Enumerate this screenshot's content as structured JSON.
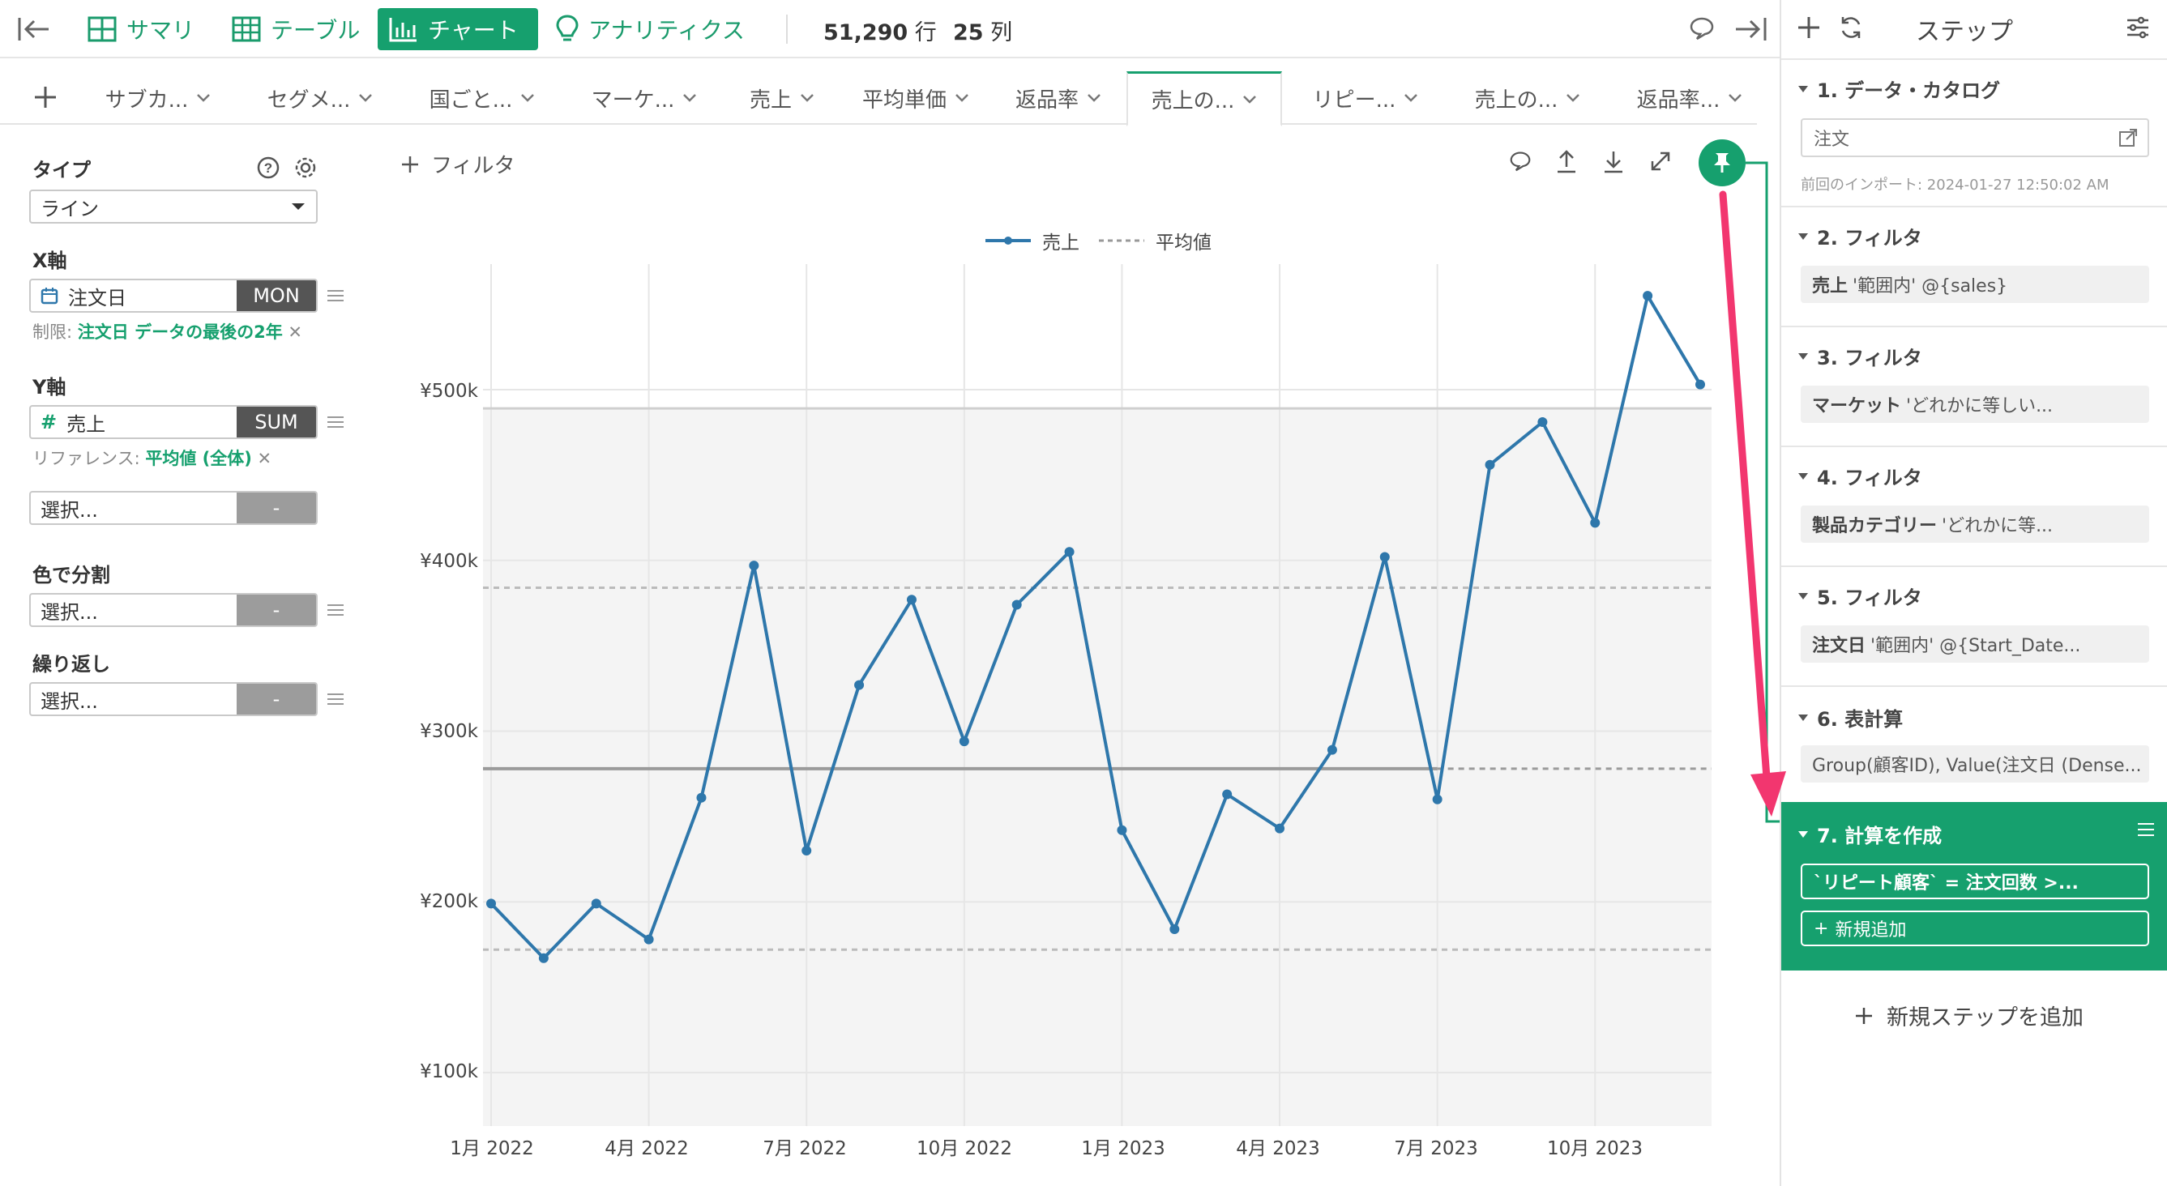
{
  "toolbar": {
    "summary": "サマリ",
    "table": "テーブル",
    "chart": "チャート",
    "analytics": "アナリティクス",
    "rows_value": "51,290",
    "rows_unit": "行",
    "cols_value": "25",
    "cols_unit": "列"
  },
  "tabs": [
    {
      "label": "サブカ..."
    },
    {
      "label": "セグメ..."
    },
    {
      "label": "国ごと..."
    },
    {
      "label": "マーケ..."
    },
    {
      "label": "売上"
    },
    {
      "label": "平均単価"
    },
    {
      "label": "返品率"
    },
    {
      "label": "売上の...",
      "active": true
    },
    {
      "label": "リピー..."
    },
    {
      "label": "売上の..."
    },
    {
      "label": "返品率..."
    }
  ],
  "config": {
    "type_label": "タイプ",
    "type_value": "ライン",
    "x_label": "X軸",
    "x_field": "注文日",
    "x_agg": "MON",
    "x_limit_prefix": "制限:",
    "x_limit_value": "注文日 データの最後の2年",
    "y_label": "Y軸",
    "y_field": "売上",
    "y_agg": "SUM",
    "y_ref_prefix": "リファレンス:",
    "y_ref_value": "平均値 (全体)",
    "extra_select": "選択...",
    "color_label": "色で分割",
    "color_select": "選択...",
    "repeat_label": "繰り返し",
    "repeat_select": "選択...",
    "dash": "-"
  },
  "filter_button": "フィルタ",
  "chart_data": {
    "type": "line",
    "legend": [
      "売上",
      "平均値"
    ],
    "legend_position": "top-center",
    "x": [
      "2022-01",
      "2022-02",
      "2022-03",
      "2022-04",
      "2022-05",
      "2022-06",
      "2022-07",
      "2022-08",
      "2022-09",
      "2022-10",
      "2022-11",
      "2022-12",
      "2023-01",
      "2023-02",
      "2023-03",
      "2023-04",
      "2023-05",
      "2023-06",
      "2023-07",
      "2023-08",
      "2023-09",
      "2023-10",
      "2023-11",
      "2023-12"
    ],
    "x_tick_labels": [
      "1月 2022",
      "4月 2022",
      "7月 2022",
      "10月 2022",
      "1月 2023",
      "4月 2023",
      "7月 2023",
      "10月 2023"
    ],
    "series": [
      {
        "name": "売上",
        "color": "#2e77ab",
        "values": [
          199000,
          167000,
          199000,
          178000,
          261000,
          397000,
          230000,
          327000,
          377000,
          294000,
          374000,
          405000,
          242000,
          184000,
          263000,
          243000,
          289000,
          402000,
          260000,
          456000,
          481000,
          422000,
          555000,
          503000
        ]
      }
    ],
    "reference": {
      "name": "平均値",
      "mean": 278000,
      "upper": 384000,
      "lower": 172000,
      "band_top": 489000
    },
    "y_tick_labels": [
      "¥100k",
      "¥200k",
      "¥300k",
      "¥400k",
      "¥500k"
    ],
    "ylim": [
      80000,
      570000
    ],
    "grid": true
  },
  "steps": {
    "title": "ステップ",
    "items": [
      {
        "head": "1. データ・カタログ",
        "value": "注文",
        "note": "前回のインポート: 2024-01-27 12:50:02 AM"
      },
      {
        "head": "2. フィルタ",
        "bold": "売上",
        "value": "'範囲内' @{sales}"
      },
      {
        "head": "3. フィルタ",
        "bold": "マーケット",
        "value": "'どれかに等しい..."
      },
      {
        "head": "4. フィルタ",
        "bold": "製品カテゴリー",
        "value": "'どれかに等..."
      },
      {
        "head": "5. フィルタ",
        "bold": "注文日",
        "value": "'範囲内' @{Start_Date..."
      },
      {
        "head": "6. 表計算",
        "value": "Group(顧客ID), Value(注文日 (Dense..."
      },
      {
        "head": "7. 計算を作成",
        "formula": "`リピート顧客` = 注文回数 >...",
        "add_new": "新規追加"
      }
    ],
    "add_step": "新規ステップを追加"
  }
}
